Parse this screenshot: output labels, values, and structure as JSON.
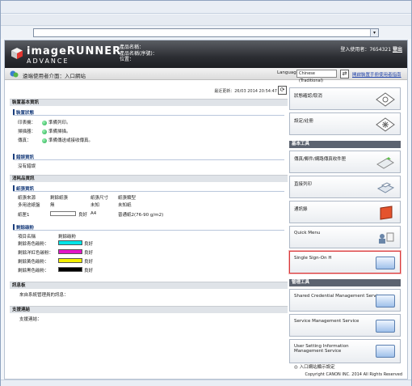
{
  "address_bar": {
    "value": ""
  },
  "brand": {
    "line1": "imageRUNNER",
    "line2": "ADVANCE"
  },
  "device_info": {
    "product_name": "產品名稱：",
    "product_name_serial": "產品名稱(序號)：",
    "location": "位置："
  },
  "login": {
    "label": "登入使用者：7654321",
    "logout": "登出"
  },
  "page": {
    "title": "遠端使用者介面：入口網站"
  },
  "language": {
    "label": "Language:",
    "selected": "Chinese (Traditional)",
    "manual_link": "開啟裝置手冊使用者指南"
  },
  "updated": "最近更新：26/03 2014 20:54:47",
  "device_basic_info": {
    "header": "裝置基本資訊",
    "status_sub": "裝置狀態",
    "items": [
      {
        "label": "印表機：",
        "status": "準備列印。"
      },
      {
        "label": "掃描器：",
        "status": "準備掃描。"
      },
      {
        "label": "傳真：",
        "status": "準備傳送或接收傳真。"
      }
    ],
    "error_sub": "錯誤資訊",
    "error_text": "沒有錯誤"
  },
  "consumables": {
    "header": "消耗品資訊",
    "paper_sub": "紙張資訊",
    "paper_headers": [
      "紙張來源",
      "剩餘紙張",
      "紙張尺寸",
      "紙張類型"
    ],
    "paper_rows": [
      [
        "多用途紙盤",
        "無",
        "未知",
        "未知紙"
      ],
      [
        "紙匣1",
        "良好",
        "A4",
        "普通紙2(76-90 g/m2)"
      ]
    ],
    "toner_sub": "剩餘碳粉",
    "toner_headers": [
      "項目名稱",
      "剩餘碳粉"
    ],
    "toner_rows": [
      {
        "name": "剩餘青色碳粉：",
        "status": "良好",
        "color": "#00e5e8"
      },
      {
        "name": "剩餘洋紅色碳粉：",
        "status": "良好",
        "color": "#e414c8"
      },
      {
        "name": "剩餘黃色碳粉：",
        "status": "良好",
        "color": "#f4f000"
      },
      {
        "name": "剩餘黑色碳粉：",
        "status": "良好",
        "color": "#000000"
      }
    ]
  },
  "messages": {
    "header": "訊息板",
    "text": "來自系統管理員的訊息："
  },
  "support": {
    "header": "支援連結",
    "text": "支援連結："
  },
  "right_panel": {
    "status_monitor": "狀態確認/取消",
    "settings": "設定/註冊",
    "basic_tools_header": "基本工具",
    "tools": [
      {
        "label": "傳真/郵件/網路傳真收件匣",
        "icon": "inbox-icon"
      },
      {
        "label": "直接列印",
        "icon": "printer-icon"
      },
      {
        "label": "通訊錄",
        "icon": "address-book-icon"
      },
      {
        "label": "Quick Menu",
        "icon": "quick-menu-icon"
      },
      {
        "label": "Single Sign-On H",
        "icon": "sso-icon"
      }
    ],
    "mgmt_tools_header": "管理工具",
    "mgmt": [
      {
        "label": "Shared Credential Management Service"
      },
      {
        "label": "Service Management Service"
      },
      {
        "label": "User Setting Information Management Service"
      }
    ],
    "portal_link": "入口網站顯示設定"
  },
  "copyright": "Copyright CANON INC. 2014 All Rights Reserved"
}
